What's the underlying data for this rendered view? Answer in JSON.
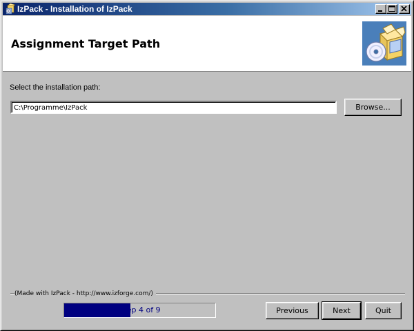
{
  "window": {
    "title": "IzPack - Installation of IzPack"
  },
  "header": {
    "title": "Assignment Target Path"
  },
  "content": {
    "path_label": "Select the installation path:",
    "path_value": "C:\\Programme\\IzPack",
    "browse_label": "Browse..."
  },
  "footer": {
    "made_with": "(Made with IzPack - http://www.izforge.com/)",
    "progress_text": "Step 4 of 9",
    "progress_fraction": 0.44,
    "previous_label": "Previous",
    "next_label": "Next",
    "quit_label": "Quit"
  },
  "colors": {
    "face": "#c0c0c0",
    "title_start": "#0a246a",
    "title_end": "#a6caf0",
    "progress_fill": "#000080"
  }
}
